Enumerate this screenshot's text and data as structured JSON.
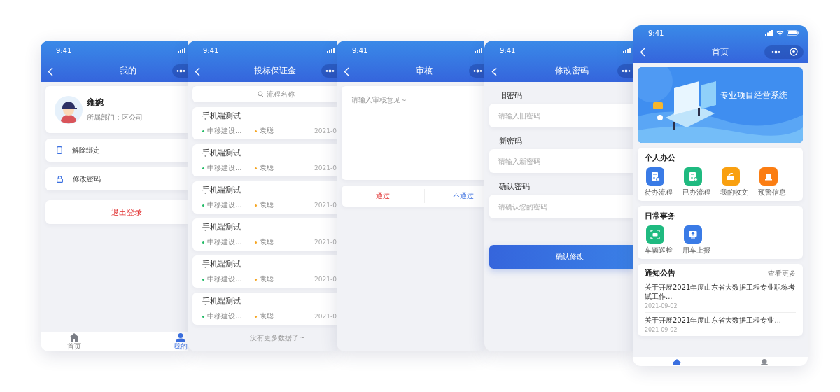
{
  "screens": [
    {
      "kind": "profile",
      "time": "9:41",
      "title": "我的",
      "user": {
        "name": "雍婉",
        "department": "所属部门：区公司"
      },
      "menu": [
        {
          "kind": "phone",
          "label": "解除绑定"
        },
        {
          "kind": "lock",
          "label": "修改密码"
        }
      ],
      "logout": "退出登录",
      "tabs": [
        {
          "kind": "home",
          "label": "首页",
          "selected": false
        },
        {
          "kind": "user",
          "label": "我的",
          "selected": true
        }
      ]
    },
    {
      "kind": "list",
      "time": "9:41",
      "title": "投标保证金",
      "search": {
        "placeholder": "流程名称"
      },
      "items": [
        {
          "title": "手机端测试",
          "tags": [
            {
              "text": "中移建设...",
              "color": "#22bb66"
            },
            {
              "text": "袁聪",
              "color": "#f5a623"
            }
          ],
          "date": "2021-0"
        },
        {
          "title": "手机端测试",
          "tags": [
            {
              "text": "中移建设...",
              "color": "#22bb66"
            },
            {
              "text": "袁聪",
              "color": "#f5a623"
            }
          ],
          "date": "2021-0"
        },
        {
          "title": "手机端测试",
          "tags": [
            {
              "text": "中移建设...",
              "color": "#22bb66"
            },
            {
              "text": "袁聪",
              "color": "#f5a623"
            }
          ],
          "date": "2021-0"
        },
        {
          "title": "手机端测试",
          "tags": [
            {
              "text": "中移建设...",
              "color": "#22bb66"
            },
            {
              "text": "袁聪",
              "color": "#f5a623"
            }
          ],
          "date": "2021-0"
        },
        {
          "title": "手机端测试",
          "tags": [
            {
              "text": "中移建设...",
              "color": "#22bb66"
            },
            {
              "text": "袁聪",
              "color": "#f5a623"
            }
          ],
          "date": "2021-0"
        },
        {
          "title": "手机端测试",
          "tags": [
            {
              "text": "中移建设...",
              "color": "#22bb66"
            },
            {
              "text": "袁聪",
              "color": "#f5a623"
            }
          ],
          "date": "2021-0"
        }
      ],
      "footer": "没有更多数据了~"
    },
    {
      "kind": "review",
      "time": "9:41",
      "title": "审核",
      "comment": {
        "placeholder": "请输入审核意见～"
      },
      "actions": [
        {
          "kind": "approve",
          "label": "通过"
        },
        {
          "kind": "reject",
          "label": "不通过"
        }
      ]
    },
    {
      "kind": "password",
      "time": "9:41",
      "title": "修改密码",
      "fields": [
        {
          "label": "旧密码",
          "placeholder": "请输入旧密码"
        },
        {
          "label": "新密码",
          "placeholder": "请输入新密码"
        },
        {
          "label": "确认密码",
          "placeholder": "请确认您的密码"
        }
      ],
      "submit": "确认修改"
    },
    {
      "kind": "home",
      "time": "9:41",
      "title": "首页",
      "banner": {
        "kind": "picture",
        "title": "专业项目经营系统"
      },
      "sections": [
        {
          "title": "个人办公",
          "items": [
            {
              "kind": "pending",
              "label": "待办流程",
              "color": "#3a7be6"
            },
            {
              "kind": "done",
              "label": "已办流程",
              "color": "#1fba80"
            },
            {
              "kind": "inbox",
              "label": "我的收文",
              "color": "#f9a010"
            },
            {
              "kind": "alarm",
              "label": "预警信息",
              "color": "#fb7d12"
            }
          ]
        },
        {
          "title": "日常事务",
          "items": [
            {
              "kind": "car",
              "label": "车辆巡检",
              "color": "#1fba80"
            },
            {
              "kind": "upload",
              "label": "用车上报",
              "color": "#3a7be6"
            }
          ]
        }
      ],
      "notices": {
        "title": "通知公告",
        "more": "查看更多",
        "items": [
          {
            "title": "关于开展2021年度山东省大数据工程专业职称考试工作...",
            "date": "2021-09-02"
          },
          {
            "title": "关于开展2021年度山东省大数据工程专业...",
            "date": "2021-09-02"
          }
        ]
      },
      "tabs": [
        {
          "kind": "home",
          "selected": true
        },
        {
          "kind": "user",
          "selected": false
        }
      ]
    }
  ]
}
